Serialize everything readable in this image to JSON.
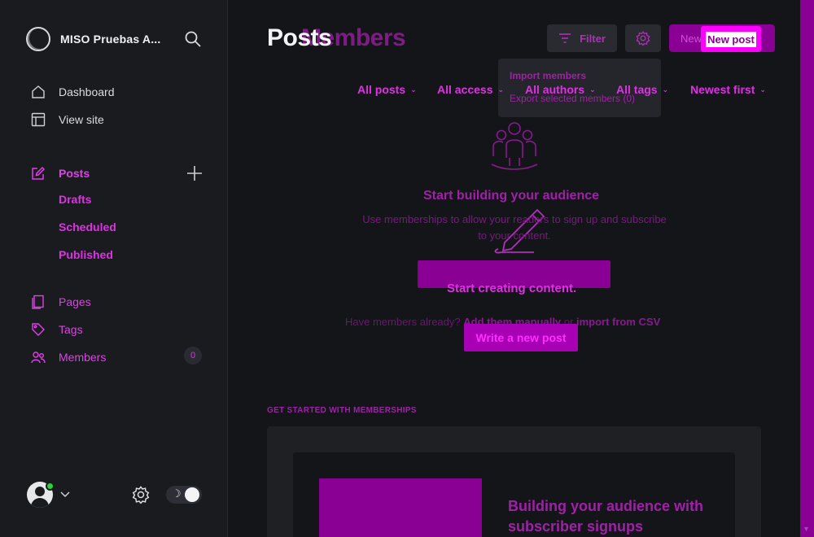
{
  "sidebar": {
    "site_name": "MISO Pruebas A...",
    "nav": {
      "dashboard": "Dashboard",
      "view_site": "View site",
      "posts": "Posts",
      "drafts": "Drafts",
      "scheduled": "Scheduled",
      "published": "Published",
      "pages": "Pages",
      "tags": "Tags",
      "members": "Members"
    },
    "members_count": "0"
  },
  "header": {
    "title": "Posts",
    "title_ghost": "Members",
    "filter_label": "Filter",
    "new_member_label": "New m",
    "new_post_label": "New post"
  },
  "dropdown": {
    "import": "Import members",
    "export": "Export selected members (0)"
  },
  "filters": {
    "all_posts": "All posts",
    "all_access": "All access",
    "all_authors": "All authors",
    "all_tags": "All tags",
    "sort": "Newest first"
  },
  "empty_state": {
    "title": "Start building your audience",
    "description": "Use memberships to allow your readers to sign up and subscribe to your content.",
    "cta_overlay": "Start creating content.",
    "have_members_prefix": "Have members already?",
    "add_manually": "Add them manually",
    "or": "or",
    "import_csv": "import from CSV",
    "write_post": "Write a new post"
  },
  "get_started": {
    "section_label": "GET STARTED WITH MEMBERSHIPS",
    "card_title": "Building your audience with subscriber signups"
  },
  "colors": {
    "accent": "#e030e6",
    "accent_dark": "#8a0094",
    "background": "#141518",
    "sidebar": "#1a1b1f",
    "online": "#30cf43"
  }
}
